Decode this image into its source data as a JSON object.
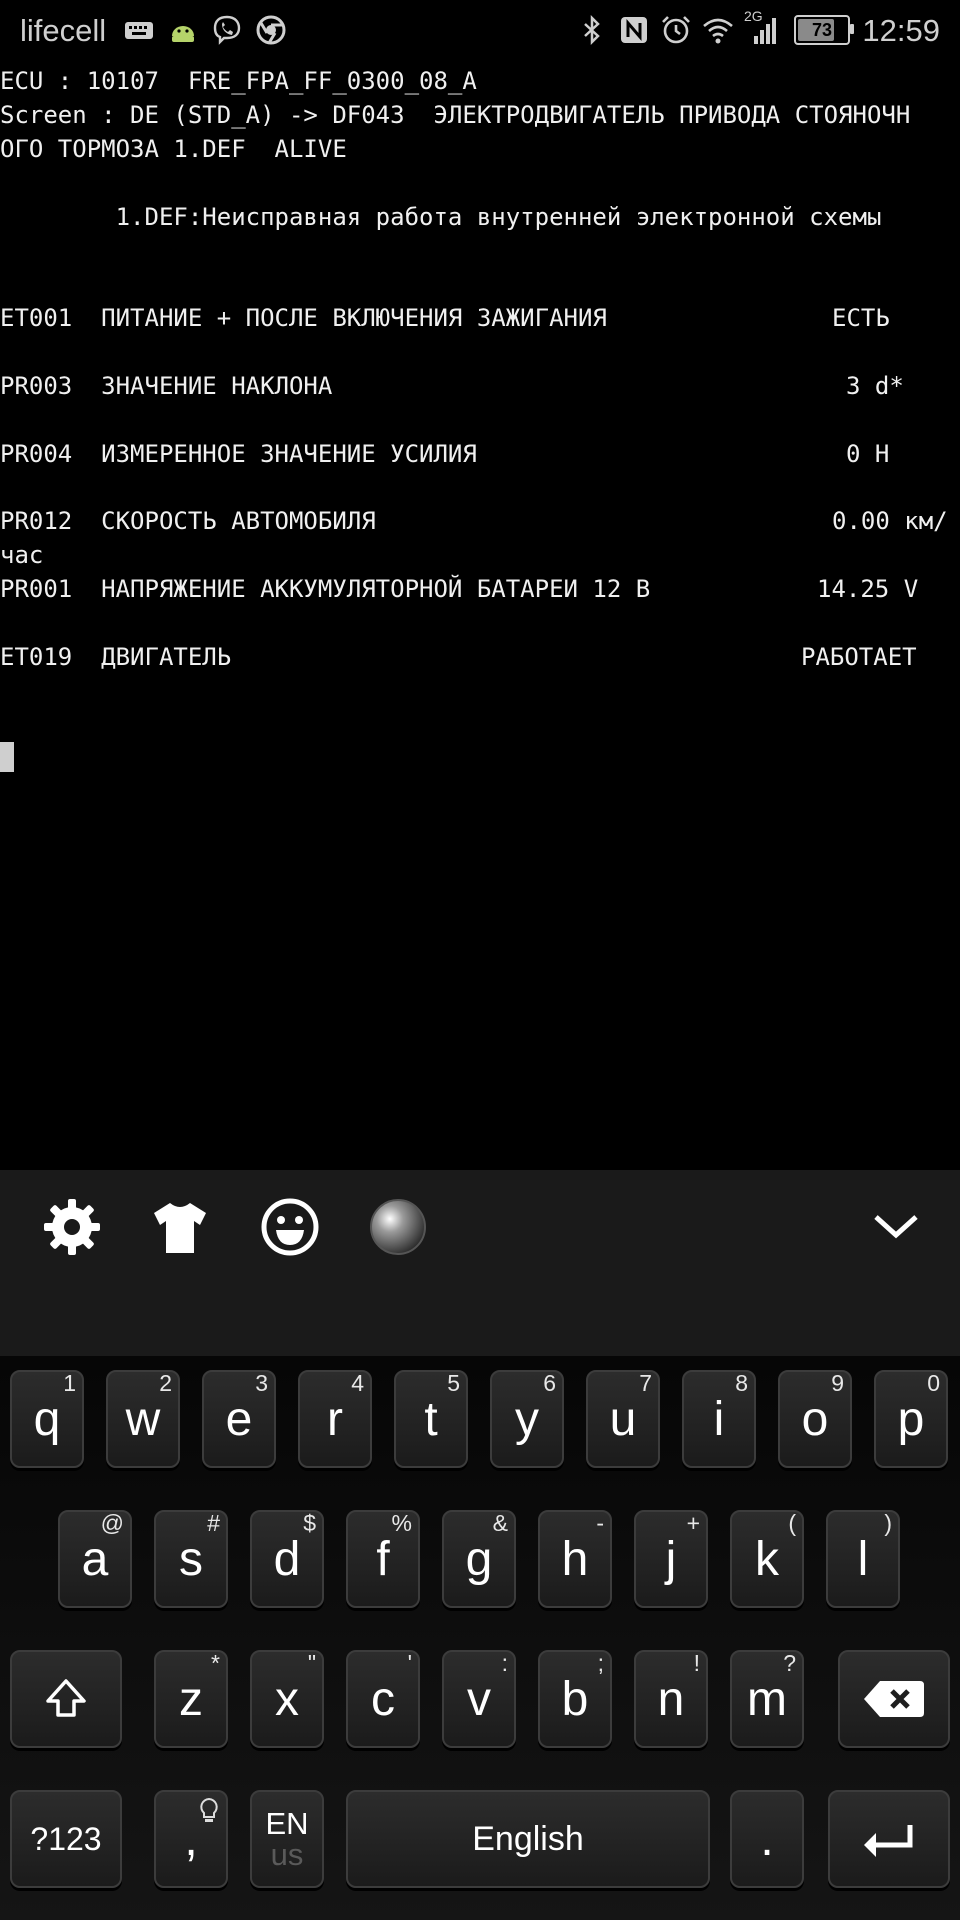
{
  "status_bar": {
    "carrier": "lifecell",
    "network_type": "2G",
    "battery_level": "73",
    "time": "12:59",
    "icons": [
      "keyboard-icon",
      "android-icon",
      "viber-icon",
      "chrome-icon",
      "bluetooth-icon",
      "nfc-icon",
      "alarm-icon",
      "wifi-icon",
      "signal-icon",
      "battery-icon"
    ]
  },
  "terminal": {
    "lines": [
      "ECU : 10107  FRE_FPA_FF_0300_08_A",
      "Screen : DE (STD_A) -> DF043  ЭЛЕКТРОДВИГАТЕЛЬ ПРИВОДА СТОЯНОЧН",
      "ОГО ТОРМОЗА 1.DEF  ALIVE",
      "        1.DEF:Неисправная работа внутренней электронной схемы"
    ],
    "params": [
      {
        "row": "ET001  ПИТАНИЕ + ПОСЛЕ ВКЛЮЧЕНИЯ ЗАЖИГАНИЯ",
        "value": "ЕСТЬ"
      },
      {
        "row": "PR003  ЗНАЧЕНИЕ НАКЛОНА",
        "value": "3 d*"
      },
      {
        "row": "PR004  ИЗМЕРЕННОЕ ЗНАЧЕНИЕ УСИЛИЯ",
        "value": "0 Н"
      },
      {
        "row": "PR012  СКОРОСТЬ АВТОМОБИЛЯ",
        "value": "0.00 км/",
        "value_wrap": "час"
      },
      {
        "row": "PR001  НАПРЯЖЕНИЕ АККУМУЛЯТОРНОЙ БАТАРЕИ 12 В",
        "value": "14.25 V"
      },
      {
        "row": "ET019  ДВИГАТЕЛЬ",
        "value": "РАБОТАЕТ"
      }
    ]
  },
  "keyboard": {
    "toolbar_icons": [
      "settings-icon",
      "theme-shirt-icon",
      "emoji-icon",
      "voice-orb-icon",
      "collapse-chevron-icon"
    ],
    "row1": [
      {
        "k": "q",
        "s": "1"
      },
      {
        "k": "w",
        "s": "2"
      },
      {
        "k": "e",
        "s": "3"
      },
      {
        "k": "r",
        "s": "4"
      },
      {
        "k": "t",
        "s": "5"
      },
      {
        "k": "y",
        "s": "6"
      },
      {
        "k": "u",
        "s": "7"
      },
      {
        "k": "i",
        "s": "8"
      },
      {
        "k": "o",
        "s": "9"
      },
      {
        "k": "p",
        "s": "0"
      }
    ],
    "row2": [
      {
        "k": "a",
        "s": "@"
      },
      {
        "k": "s",
        "s": "#"
      },
      {
        "k": "d",
        "s": "$"
      },
      {
        "k": "f",
        "s": "%"
      },
      {
        "k": "g",
        "s": "&"
      },
      {
        "k": "h",
        "s": "-"
      },
      {
        "k": "j",
        "s": "+"
      },
      {
        "k": "k",
        "s": "("
      },
      {
        "k": "l",
        "s": ")"
      }
    ],
    "row3": [
      {
        "k": "z",
        "s": "*"
      },
      {
        "k": "x",
        "s": "\""
      },
      {
        "k": "c",
        "s": "'"
      },
      {
        "k": "v",
        "s": ":"
      },
      {
        "k": "b",
        "s": ";"
      },
      {
        "k": "n",
        "s": "!"
      },
      {
        "k": "m",
        "s": "?"
      }
    ],
    "symbols_label": "?123",
    "comma_label": ",",
    "lang_top": "EN",
    "lang_bottom": "us",
    "space_label": "English",
    "period_label": "."
  }
}
